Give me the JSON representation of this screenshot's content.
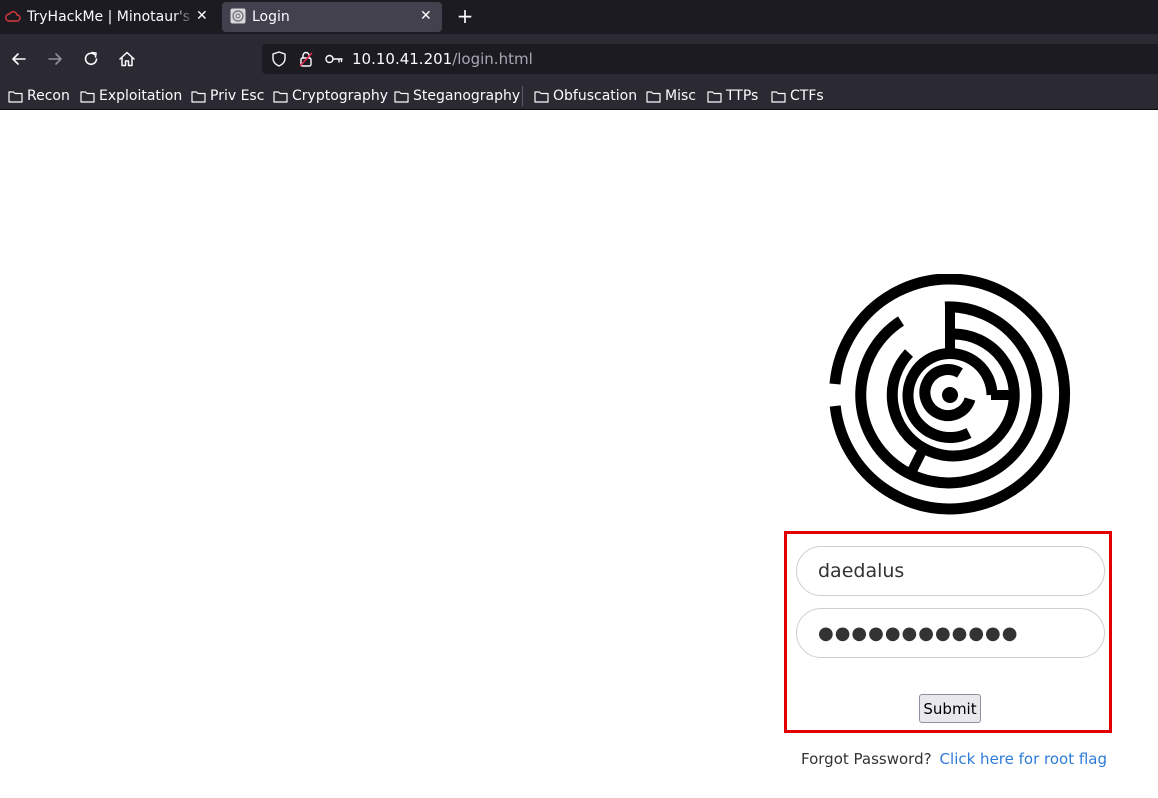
{
  "browser": {
    "tabs": [
      {
        "title": "TryHackMe | Minotaur's Labyrinth",
        "active": false
      },
      {
        "title": "Login",
        "active": true
      }
    ],
    "url": {
      "host": "10.10.41.201",
      "path": "/login.html"
    },
    "bookmarks": [
      "Recon",
      "Exploitation",
      "Priv Esc",
      "Cryptography",
      "Steganography",
      "Obfuscation",
      "Misc",
      "TTPs",
      "CTFs"
    ]
  },
  "login": {
    "username_value": "daedalus",
    "password_display": "●●●●●●●●●●●●",
    "submit_label": "Submit",
    "forgot_label": "Forgot Password?",
    "root_flag_link": "Click here for root flag"
  },
  "colors": {
    "highlight": "#e00000",
    "link": "#2f7bd8",
    "tabbar": "#1c1b22",
    "toolbar": "#2b2a33"
  }
}
